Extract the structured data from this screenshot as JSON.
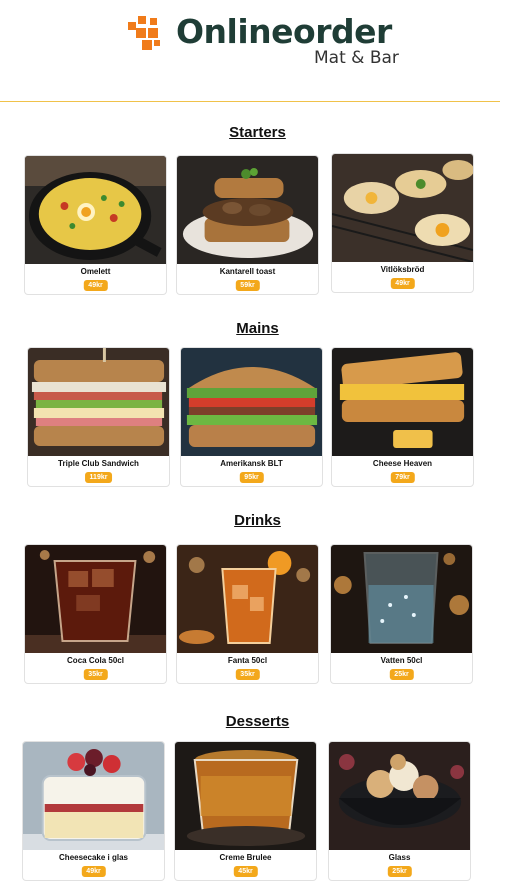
{
  "brand": {
    "name": "Onlineorder",
    "tagline": "Mat & Bar",
    "accent": "#f07b1a",
    "dark": "#1f3d36"
  },
  "sections": [
    {
      "title": "Starters",
      "items": [
        {
          "name": "Omelett",
          "price": "49kr"
        },
        {
          "name": "Kantarell toast",
          "price": "59kr"
        },
        {
          "name": "Vitlöksbröd",
          "price": "49kr"
        }
      ]
    },
    {
      "title": "Mains",
      "items": [
        {
          "name": "Triple Club Sandwich",
          "price": "119kr"
        },
        {
          "name": "Amerikansk BLT",
          "price": "95kr"
        },
        {
          "name": "Cheese Heaven",
          "price": "79kr"
        }
      ]
    },
    {
      "title": "Drinks",
      "items": [
        {
          "name": "Coca Cola 50cl",
          "price": "35kr"
        },
        {
          "name": "Fanta 50cl",
          "price": "35kr"
        },
        {
          "name": "Vatten 50cl",
          "price": "25kr"
        }
      ]
    },
    {
      "title": "Desserts",
      "items": [
        {
          "name": "Cheesecake i glas",
          "price": "49kr"
        },
        {
          "name": "Creme Brulee",
          "price": "45kr"
        },
        {
          "name": "Glass",
          "price": "25kr"
        }
      ]
    }
  ]
}
